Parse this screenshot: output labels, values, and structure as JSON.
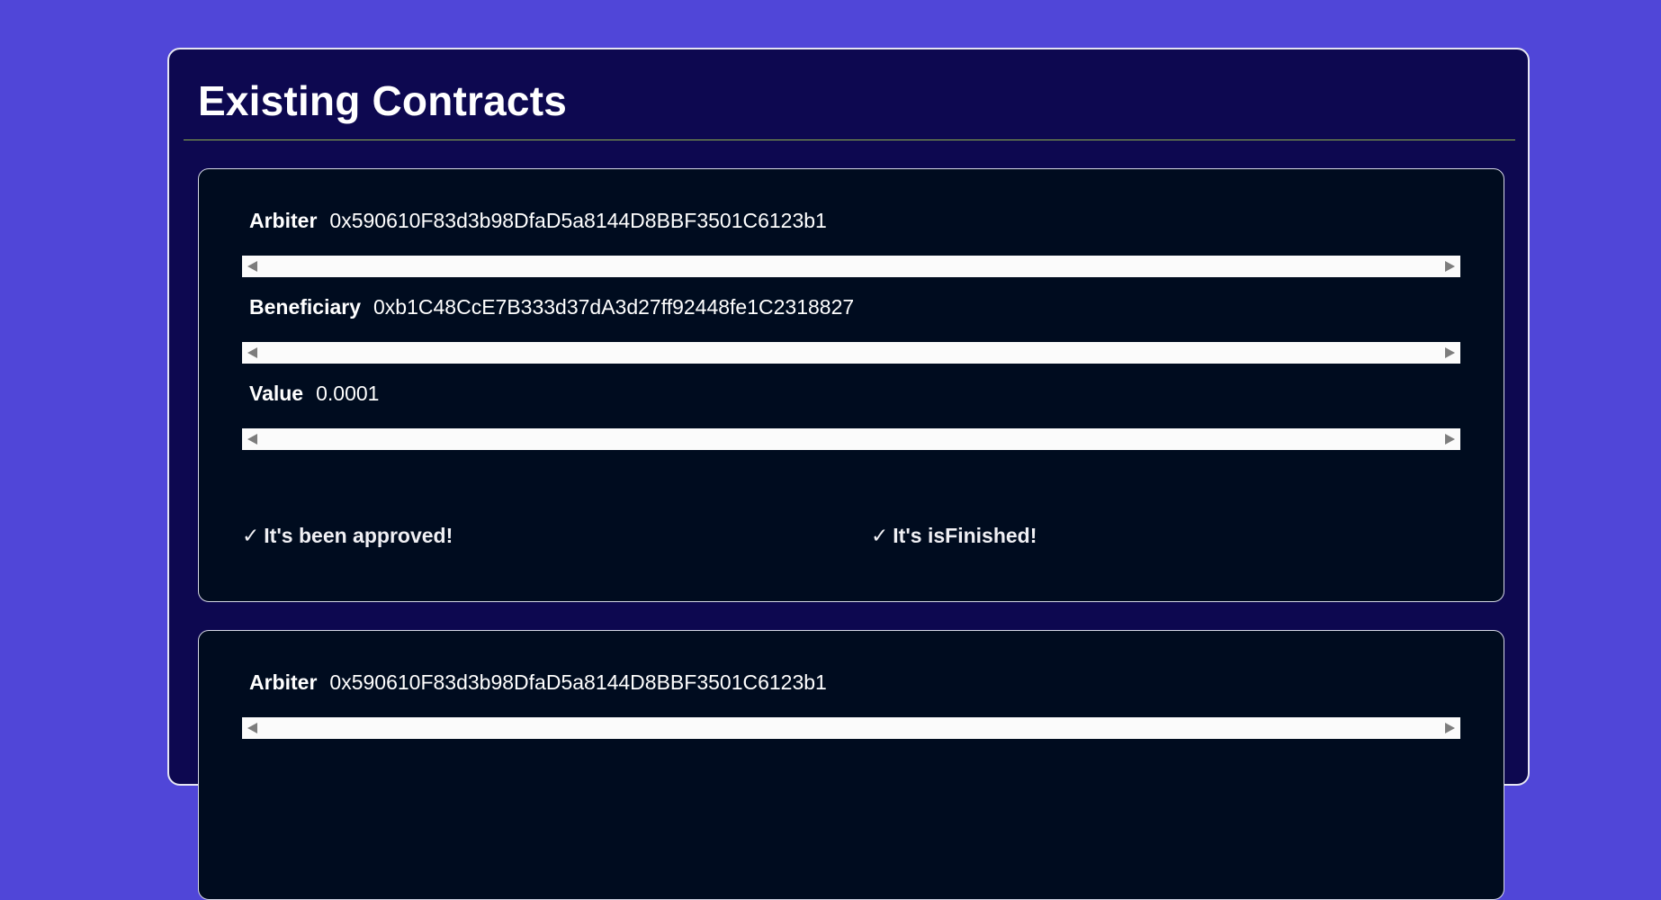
{
  "page": {
    "title": "Existing Contracts"
  },
  "contracts": [
    {
      "fields": [
        {
          "label": "Arbiter",
          "value": "0x590610F83d3b98DfaD5a8144D8BBF3501C6123b1"
        },
        {
          "label": "Beneficiary",
          "value": "0xb1C48CcE7B333d37dA3d27ff92448fe1C2318827"
        },
        {
          "label": "Value",
          "value": "0.0001"
        }
      ],
      "statuses": [
        {
          "icon": "✓",
          "text": "It's been approved!"
        },
        {
          "icon": "✓",
          "text": "It's isFinished!"
        }
      ]
    },
    {
      "fields": [
        {
          "label": "Arbiter",
          "value": "0x590610F83d3b98DfaD5a8144D8BBF3501C6123b1"
        }
      ]
    }
  ],
  "icons": {
    "status": "check-icon",
    "scroll_left": "triangle-left-icon",
    "scroll_right": "triangle-right-icon"
  },
  "colors": {
    "background": "#5046d8",
    "panel": "#0d0850",
    "card": "#000c1f",
    "rule": "#8fb04a",
    "text": "#ffffff"
  }
}
